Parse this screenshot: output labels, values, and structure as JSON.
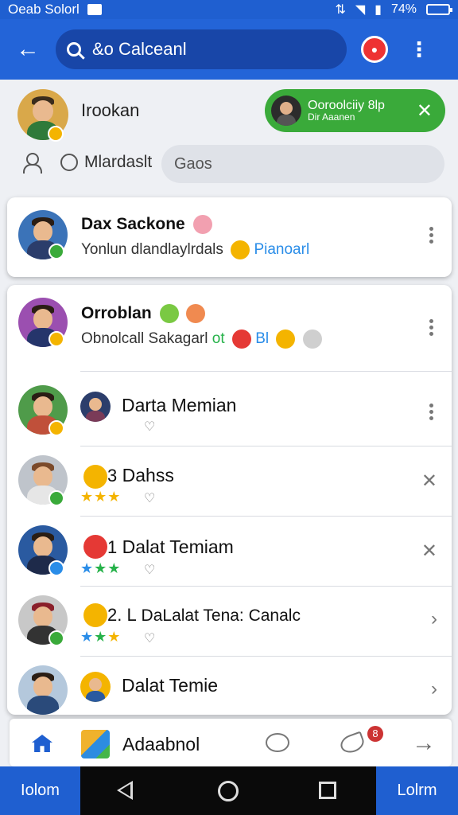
{
  "status_bar": {
    "app_label": "Oeab Solorl",
    "battery": "74%"
  },
  "app_bar": {
    "search_text": "&o Calceanl"
  },
  "profile": {
    "name": "Irookan",
    "toast": {
      "title": "Ooroolciiy 8lp",
      "subtitle": "Dir Aaanen"
    },
    "secondary_label": "Mlardaslt",
    "input_value": "Gaos"
  },
  "highlight_card": {
    "name": "Dax Sackone",
    "subtitle": "Yonlun dlandlaylrdals",
    "tag": "Pianoarl"
  },
  "list": {
    "header": {
      "name": "Orroblan",
      "subtitle": "Obnolcall Sakagarl",
      "tail": "ot",
      "tail2": "Bl"
    },
    "rows": [
      {
        "prefix": "",
        "name": "Darta Memian"
      },
      {
        "prefix": "3",
        "name": "Dahss"
      },
      {
        "prefix": "1",
        "name": "Dalat Temiam"
      },
      {
        "prefix": "2. L",
        "name": "DaLalat Tena: Canalc"
      },
      {
        "prefix": "",
        "name": "Dalat Temie"
      }
    ]
  },
  "bottom_nav": {
    "label": "Adaabnol",
    "badge": "8"
  },
  "system_bar": {
    "left": "Iolom",
    "right": "Lolrm"
  },
  "colors": {
    "primary": "#2364d8",
    "toast_green": "#3aaa3a"
  }
}
